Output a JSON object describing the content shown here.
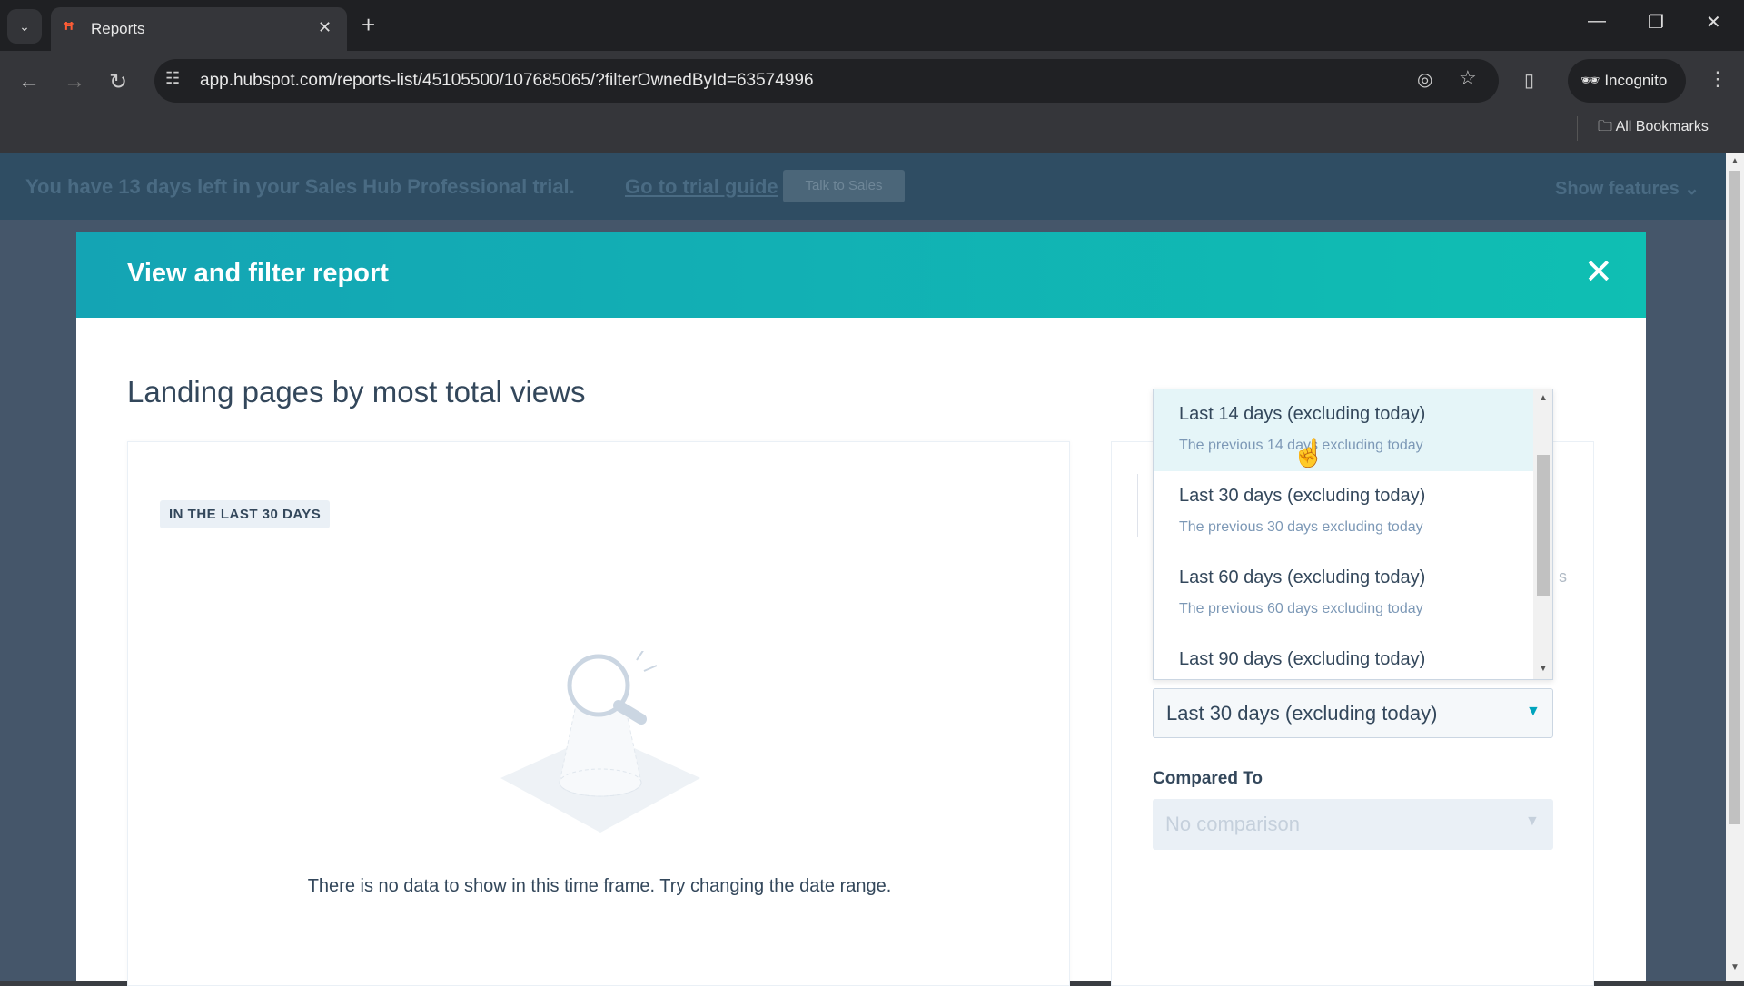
{
  "browser": {
    "tab_title": "Reports",
    "url": "app.hubspot.com/reports-list/45105500/107685065/?filterOwnedById=63574996",
    "incognito_label": "Incognito",
    "bookmarks_label": "All Bookmarks"
  },
  "banner": {
    "message": "You have 13 days left in your Sales Hub Professional trial.",
    "link": "Go to trial guide",
    "button": "Talk to Sales",
    "show_features": "Show features"
  },
  "modal": {
    "title": "View and filter report",
    "report_title": "Landing pages by most total views",
    "badge": "IN THE LAST 30 DAYS",
    "empty_message": "There is no data to show in this time frame. Try changing the date range.",
    "date_options": [
      {
        "label": "Last 14 days (excluding today)",
        "description": "The previous 14 days excluding today",
        "hovered": true
      },
      {
        "label": "Last 30 days (excluding today)",
        "description": "The previous 30 days excluding today"
      },
      {
        "label": "Last 60 days (excluding today)",
        "description": "The previous 60 days excluding today"
      },
      {
        "label": "Last 90 days (excluding today)",
        "description": ""
      }
    ],
    "date_selected": "Last 30 days (excluding today)",
    "compared_to_label": "Compared To",
    "compared_to_value": "No comparison",
    "ghost_text": "s"
  },
  "colors": {
    "header_teal": "#0fb1b8",
    "accent": "#00a4bd",
    "text": "#33475b"
  }
}
